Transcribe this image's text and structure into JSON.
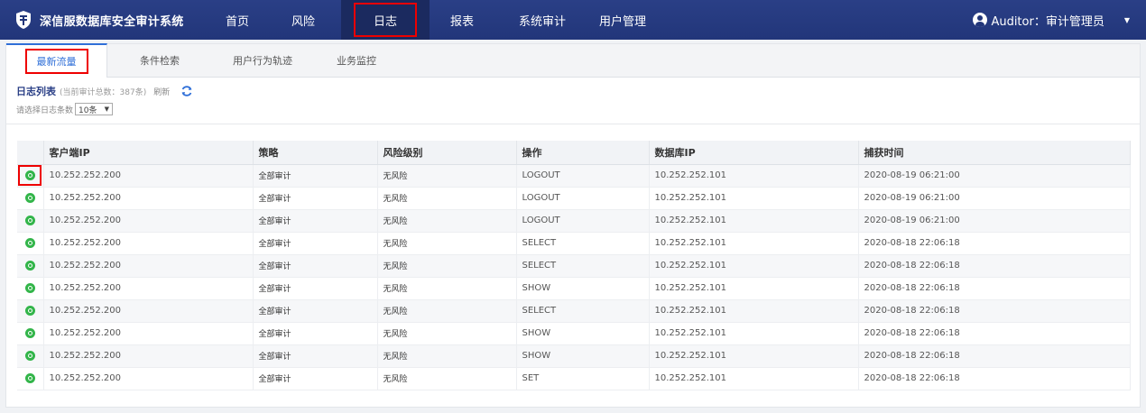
{
  "app": {
    "title": "深信服数据库安全审计系统"
  },
  "nav": {
    "items": [
      {
        "label": "首页"
      },
      {
        "label": "风险"
      },
      {
        "label": "日志"
      },
      {
        "label": "报表"
      },
      {
        "label": "系统审计"
      },
      {
        "label": "用户管理"
      }
    ],
    "active_index": 2
  },
  "user": {
    "label": "Auditor：审计管理员"
  },
  "tabs": [
    {
      "label": "最新流量"
    },
    {
      "label": "条件检索"
    },
    {
      "label": "用户行为轨迹"
    },
    {
      "label": "业务监控"
    }
  ],
  "log_list": {
    "title": "日志列表",
    "count_text": "(当前审计总数：387条)",
    "refresh_label": "刷新",
    "select_label": "请选择日志条数",
    "select_value": "10条"
  },
  "table": {
    "columns": [
      "客户端IP",
      "策略",
      "风险级别",
      "操作",
      "数据库IP",
      "捕获时间"
    ],
    "rows": [
      [
        "10.252.252.200",
        "全部审计",
        "无风险",
        "LOGOUT",
        "10.252.252.101",
        "2020-08-19 06:21:00"
      ],
      [
        "10.252.252.200",
        "全部审计",
        "无风险",
        "LOGOUT",
        "10.252.252.101",
        "2020-08-19 06:21:00"
      ],
      [
        "10.252.252.200",
        "全部审计",
        "无风险",
        "LOGOUT",
        "10.252.252.101",
        "2020-08-19 06:21:00"
      ],
      [
        "10.252.252.200",
        "全部审计",
        "无风险",
        "SELECT",
        "10.252.252.101",
        "2020-08-18 22:06:18"
      ],
      [
        "10.252.252.200",
        "全部审计",
        "无风险",
        "SELECT",
        "10.252.252.101",
        "2020-08-18 22:06:18"
      ],
      [
        "10.252.252.200",
        "全部审计",
        "无风险",
        "SHOW",
        "10.252.252.101",
        "2020-08-18 22:06:18"
      ],
      [
        "10.252.252.200",
        "全部审计",
        "无风险",
        "SELECT",
        "10.252.252.101",
        "2020-08-18 22:06:18"
      ],
      [
        "10.252.252.200",
        "全部审计",
        "无风险",
        "SHOW",
        "10.252.252.101",
        "2020-08-18 22:06:18"
      ],
      [
        "10.252.252.200",
        "全部审计",
        "无风险",
        "SHOW",
        "10.252.252.101",
        "2020-08-18 22:06:18"
      ],
      [
        "10.252.252.200",
        "全部审计",
        "无风险",
        "SET",
        "10.252.252.101",
        "2020-08-18 22:06:18"
      ]
    ]
  },
  "colors": {
    "topbar": "#22367a",
    "accent": "#2f6fd8",
    "highlight": "#ee0000",
    "expand": "#33b54a"
  },
  "icons": {
    "brand": "shield-logo-icon",
    "user": "user-circle-icon",
    "refresh": "refresh-icon",
    "expand": "plus-circle-icon"
  }
}
